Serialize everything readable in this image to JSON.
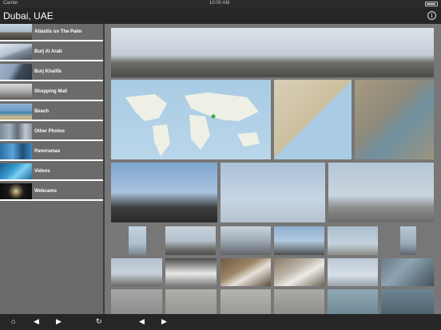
{
  "status": {
    "carrier": "Carrier",
    "time": "10:00 AM"
  },
  "nav": {
    "title": "Dubai, UAE",
    "info_glyph": "i",
    "info_icon": "info-icon"
  },
  "sidebar": {
    "items": [
      {
        "label": "Atlantis on The Palm"
      },
      {
        "label": "Burj Al Arab"
      },
      {
        "label": "Burj Khalifa"
      },
      {
        "label": "Shopping Mall"
      },
      {
        "label": "Beach"
      },
      {
        "label": "Other Photos"
      },
      {
        "label": "Panoramas"
      },
      {
        "label": "Videos"
      },
      {
        "label": "Webcams"
      }
    ]
  },
  "main": {
    "tiles_label": "photo-thumbnail"
  },
  "toolbar": {
    "home_glyph": "⌂",
    "back_glyph": "◀",
    "forward_glyph": "▶",
    "refresh_glyph": "↻",
    "main_back_glyph": "◀",
    "main_forward_glyph": "▶"
  },
  "colors": {
    "bar": "#262626",
    "sidebar": "#6b6b6b",
    "grid": "#777777",
    "accent": "#ffffff"
  }
}
